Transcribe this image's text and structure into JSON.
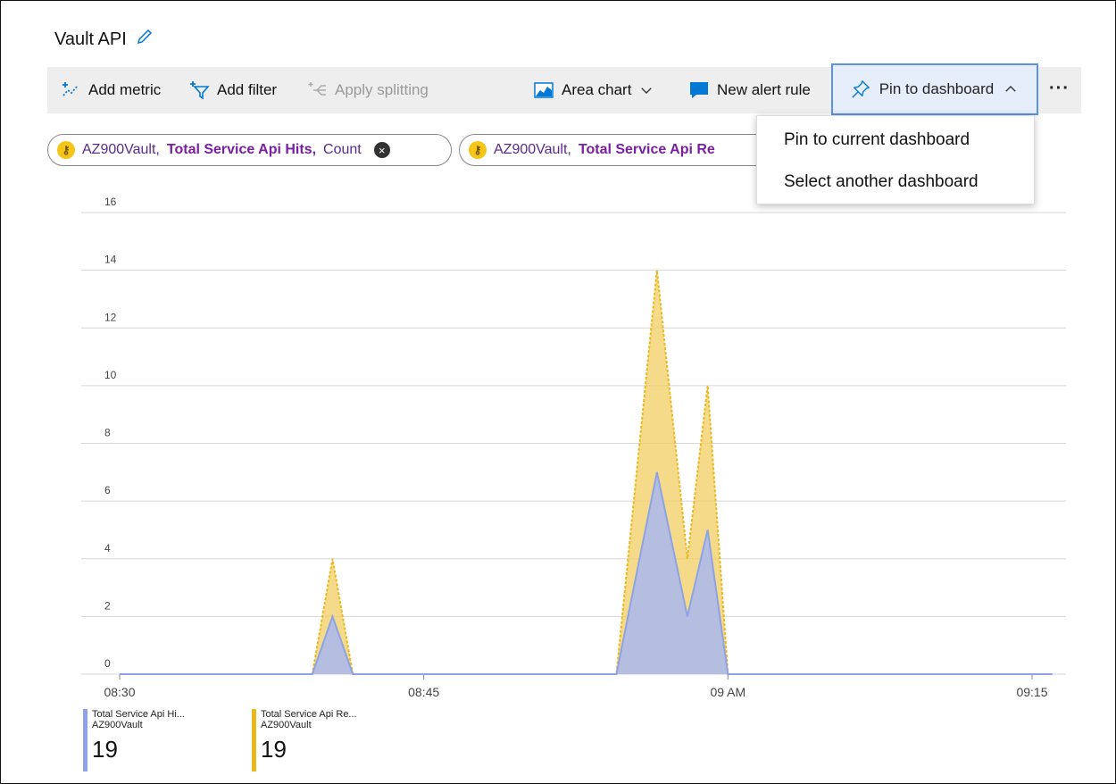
{
  "header": {
    "title": "Vault API"
  },
  "toolbar": {
    "add_metric": "Add metric",
    "add_filter": "Add filter",
    "apply_splitting": "Apply splitting",
    "area_chart": "Area chart",
    "new_alert_rule": "New alert rule",
    "pin_to_dashboard": "Pin to dashboard",
    "more": "···"
  },
  "pills": [
    {
      "resource": "AZ900Vault,",
      "metric": "Total Service Api Hits,",
      "aggregation": "Count"
    },
    {
      "resource": "AZ900Vault,",
      "metric": "Total Service Api Re",
      "aggregation": ""
    }
  ],
  "dropdown": {
    "items": [
      "Pin to current dashboard",
      "Select another dashboard"
    ]
  },
  "colors": {
    "series1": "#a9b9f0",
    "series1_line": "#8ea3e6",
    "series2": "#f1cd61",
    "series2_line": "#e9b81d",
    "accent": "#0078d4"
  },
  "chart_data": {
    "type": "area",
    "y_ticks": [
      "0",
      "2",
      "4",
      "6",
      "8",
      "10",
      "12",
      "14",
      "16"
    ],
    "x_ticks": [
      "08:30",
      "08:45",
      "09 AM",
      "09:15"
    ],
    "ylim": [
      0,
      16
    ],
    "grid": true,
    "series": [
      {
        "name": "Total Service Api Hi...",
        "resource": "AZ900Vault",
        "total": "19",
        "points": [
          [
            0,
            0
          ],
          [
            9.5,
            0
          ],
          [
            10.5,
            2
          ],
          [
            11.5,
            0
          ],
          [
            24.5,
            0
          ],
          [
            26.5,
            7
          ],
          [
            28,
            2
          ],
          [
            29,
            5
          ],
          [
            30,
            0
          ],
          [
            46,
            0
          ]
        ]
      },
      {
        "name": "Total Service Api Re...",
        "resource": "AZ900Vault",
        "total": "19",
        "points": [
          [
            0,
            0
          ],
          [
            9.5,
            0
          ],
          [
            10.5,
            4
          ],
          [
            11.5,
            0
          ],
          [
            24.5,
            0
          ],
          [
            26.5,
            14
          ],
          [
            28,
            4
          ],
          [
            29,
            10
          ],
          [
            30,
            0
          ],
          [
            46,
            0
          ]
        ]
      }
    ]
  }
}
